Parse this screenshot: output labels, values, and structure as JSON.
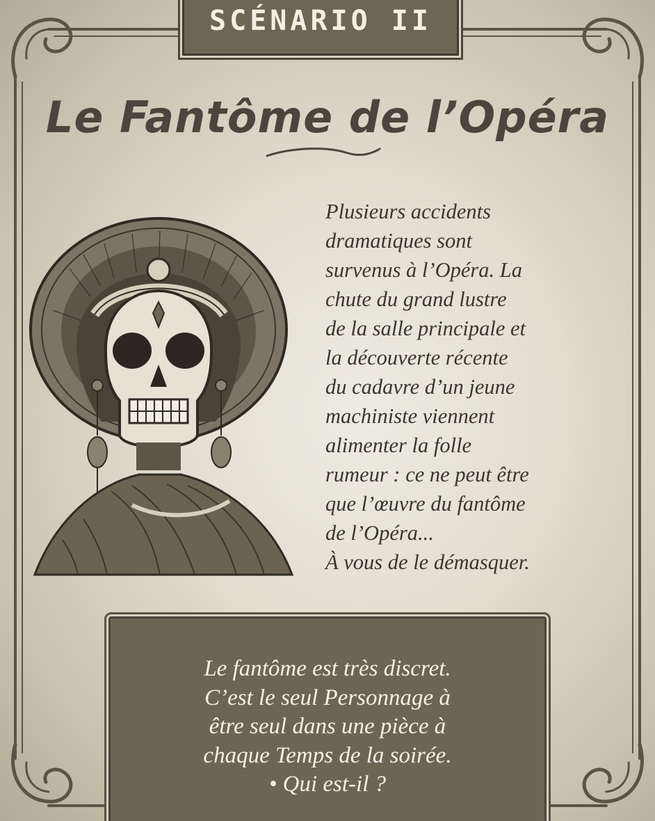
{
  "header": {
    "scenario_label": "SCÉNARIO II"
  },
  "title": "Le Fantôme de l’Opéra",
  "illustration": {
    "icon": "skull-lady-portrait-icon"
  },
  "story": {
    "text": "Plusieurs accidents\ndramatiques sont\nsurvenus à l’Opéra. La\nchute du grand lustre\nde la salle principale et\nla découverte récente\ndu cadavre d’un jeune\nmachiniste viennent\nalimenter la folle\nrumeur : ce ne peut être\nque l’œuvre du fantôme\nde l’Opéra...\nÀ vous de le démasquer."
  },
  "hint": {
    "text": "Le fantôme est très discret.\nC’est le seul Personnage à\nêtre seul dans une pièce à\nchaque Temps de la soirée.\n• Qui est-il ?"
  },
  "colors": {
    "parchment": "#e1ddcf",
    "panel": "#6d6554",
    "ink": "#3a362f",
    "panel_text": "#f4f0e6"
  }
}
